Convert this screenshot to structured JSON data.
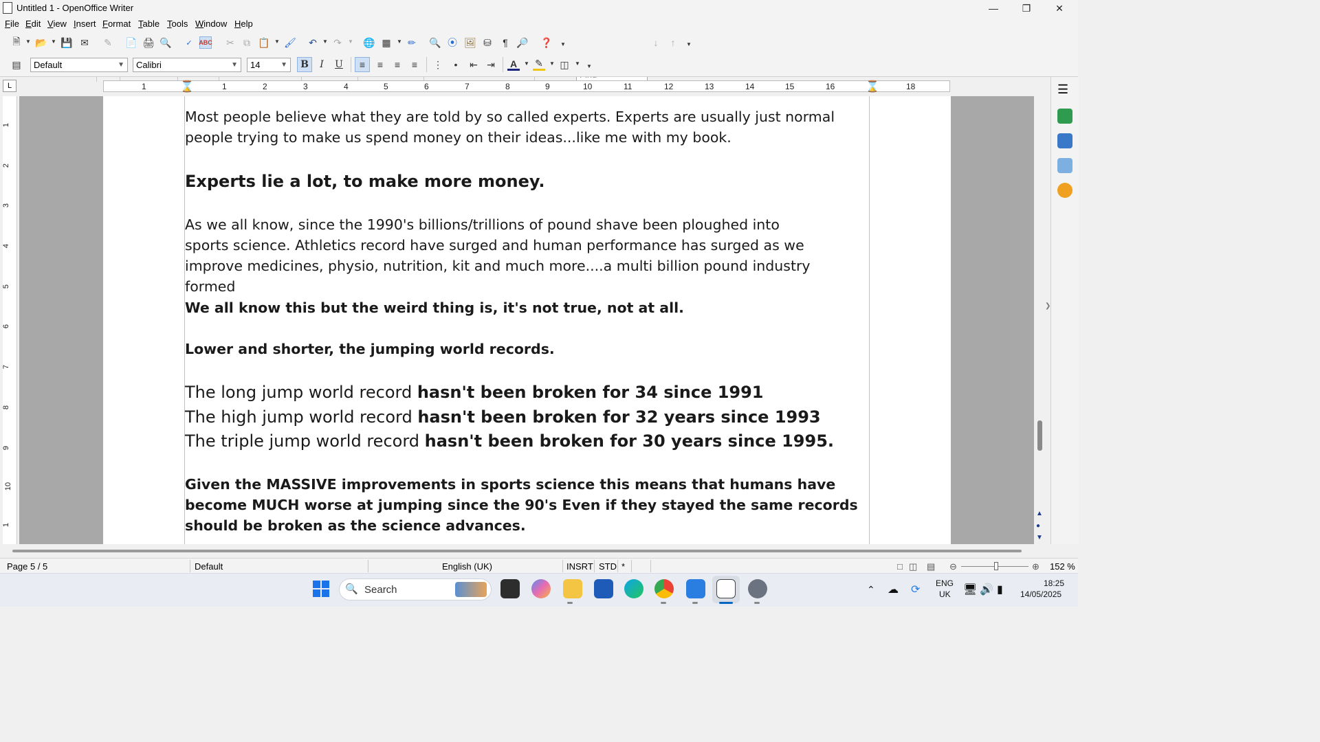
{
  "window": {
    "title": "Untitled 1 - OpenOffice Writer"
  },
  "menu": [
    "File",
    "Edit",
    "View",
    "Insert",
    "Format",
    "Table",
    "Tools",
    "Window",
    "Help"
  ],
  "toolbar": {
    "find_placeholder": "Find",
    "para_style": "Default",
    "font_name": "Calibri",
    "font_size": "14"
  },
  "ruler": {
    "h_numbers": [
      "1",
      "1",
      "2",
      "3",
      "4",
      "5",
      "6",
      "7",
      "8",
      "9",
      "10",
      "11",
      "12",
      "13",
      "14",
      "15",
      "16",
      "17",
      "18"
    ],
    "v_numbers": [
      "1",
      "2",
      "3",
      "4",
      "5",
      "6",
      "7",
      "8",
      "9",
      "10",
      "1"
    ],
    "tab_symbol": "L"
  },
  "document": {
    "p1": "Most people believe what they are told by so called experts. Experts are usually just normal people trying to make us spend money on their ideas...like me with my book.",
    "h1": "Experts lie a lot, to make more money.",
    "p2": "As we all know, since the 1990's billions/trillions of pound shave been ploughed into sports science. Athletics record have surged and human performance has surged as we improve medicines, physio, nutrition, kit and much more....a multi billion pound industry formed",
    "h2": "We all know this but the weird thing is, it's not true, not at all.",
    "h3": "Lower and shorter, the jumping world records.",
    "r1_plain": "The long jump world record ",
    "r1_bold": "hasn't been broken for 34 since 1991",
    "r2_plain": "The high jump world record ",
    "r2_bold": "hasn't been broken for 32 years since 1993",
    "r3_plain": "The triple jump world record ",
    "r3_bold": "hasn't been broken for 30 years since 1995.",
    "p3": "Given the MASSIVE improvements in sports science this means that humans have become MUCH worse at jumping since the 90's Even if they stayed the same records should be broken as the science advances."
  },
  "status": {
    "page": "Page 5 / 5",
    "style": "Default",
    "language": "English (UK)",
    "insert_mode": "INSRT",
    "selection_mode": "STD",
    "modified": "*",
    "zoom": "152 %"
  },
  "taskbar": {
    "search_label": "Search",
    "lang_top": "ENG",
    "lang_bottom": "UK",
    "time": "18:25",
    "date": "14/05/2025"
  },
  "colors": {
    "accent": "#0067c0",
    "page_bg": "#ffffff",
    "workspace": "#a8a8a8"
  }
}
